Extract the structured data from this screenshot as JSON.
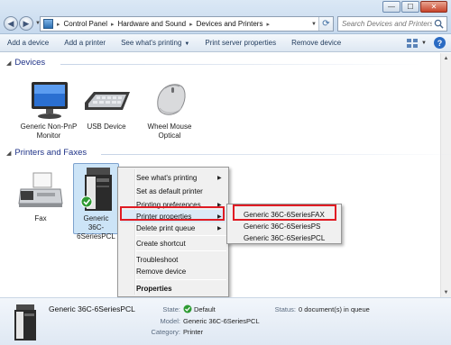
{
  "window": {
    "minimize_glyph": "—",
    "maximize_glyph": "☐",
    "close_glyph": "✕"
  },
  "navigation": {
    "breadcrumbs": [
      "Control Panel",
      "Hardware and Sound",
      "Devices and Printers"
    ],
    "separator": "▸",
    "search_placeholder": "Search Devices and Printers"
  },
  "command_bar": {
    "items": [
      {
        "label": "Add a device"
      },
      {
        "label": "Add a printer"
      },
      {
        "label": "See what's printing",
        "dropdown": "▼"
      },
      {
        "label": "Print server properties"
      },
      {
        "label": "Remove device"
      }
    ],
    "view_dropdown": "▼",
    "help_glyph": "?"
  },
  "devices_group": {
    "title": "Devices",
    "items": [
      {
        "label_line1": "Generic Non-PnP",
        "label_line2": "Monitor",
        "icon": "monitor-icon"
      },
      {
        "label_line1": "USB Device",
        "label_line2": "",
        "icon": "keyboard-icon"
      },
      {
        "label_line1": "Wheel Mouse",
        "label_line2": "Optical",
        "icon": "mouse-icon"
      }
    ]
  },
  "printers_group": {
    "title": "Printers and Faxes",
    "items": [
      {
        "label_line1": "Fax",
        "label_line2": "",
        "icon": "fax-icon"
      },
      {
        "label_line1": "Generic",
        "label_line2": "36C-6SeriesPCL",
        "icon": "printer-icon",
        "default": true
      }
    ]
  },
  "context_menu": {
    "items": [
      {
        "label": "See what's printing",
        "submenu": true
      },
      {
        "label": "Set as default printer",
        "submenu": false
      },
      {
        "label": "Printing preferences",
        "submenu": true
      },
      {
        "label": "Printer properties",
        "submenu": true
      },
      {
        "label": "Delete print queue",
        "submenu": true
      },
      {
        "label": "Create shortcut",
        "submenu": false
      },
      {
        "label": "Troubleshoot",
        "submenu": false
      },
      {
        "label": "Remove device",
        "submenu": false
      },
      {
        "label": "Properties",
        "submenu": false,
        "bold": true
      }
    ],
    "submenu_arrow": "▶"
  },
  "printer_properties_submenu": {
    "items": [
      "Generic 36C-6SeriesFAX",
      "Generic 36C-6SeriesPS",
      "Generic 36C-6SeriesPCL"
    ]
  },
  "details_pane": {
    "name": "Generic 36C-6SeriesPCL",
    "state_label": "State:",
    "state_value": "Default",
    "model_label": "Model:",
    "model_value": "Generic 36C-6SeriesPCL",
    "category_label": "Category:",
    "category_value": "Printer",
    "status_label": "Status:",
    "status_value": "0 document(s) in queue"
  },
  "colors": {
    "highlight_box": "#e01b23",
    "group_title": "#1e3287",
    "selection": "#cce4f7"
  }
}
